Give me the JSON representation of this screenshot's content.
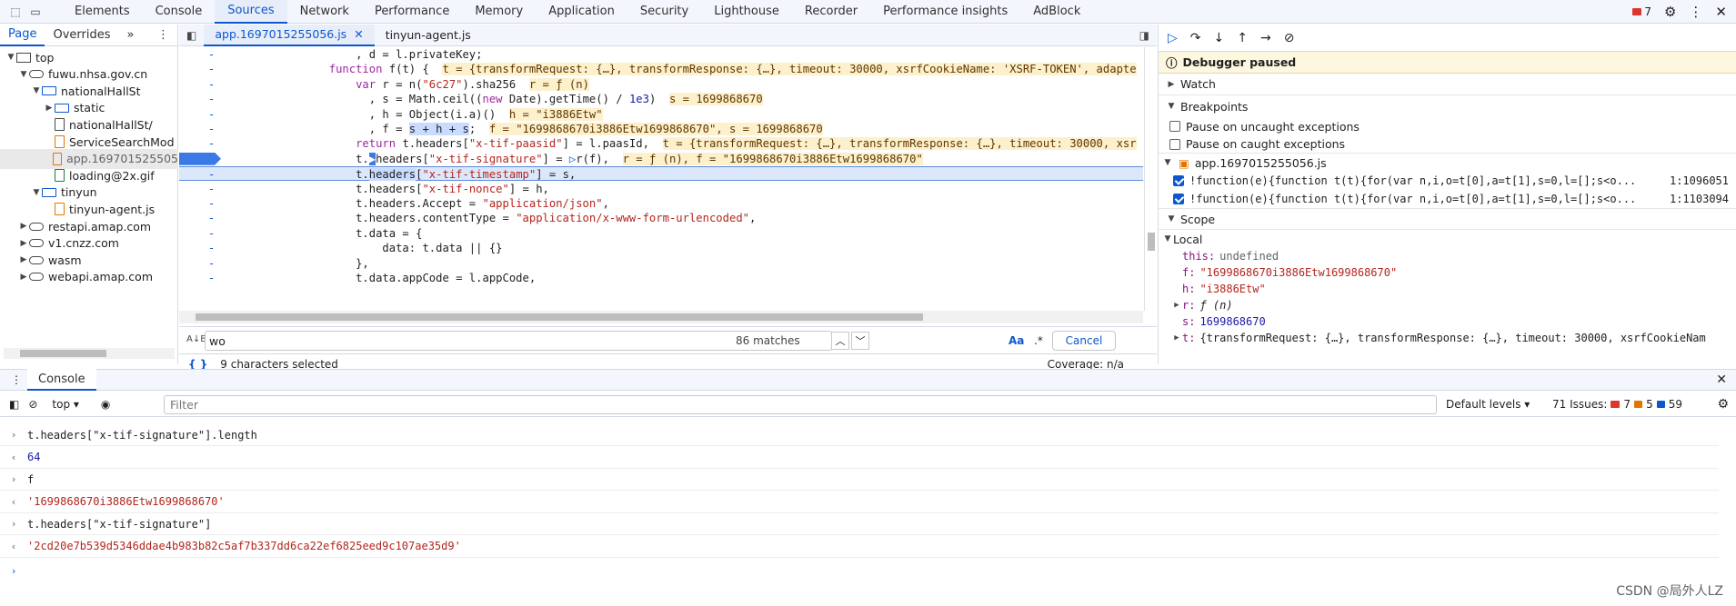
{
  "top_tabs": [
    "Elements",
    "Console",
    "Sources",
    "Network",
    "Performance",
    "Memory",
    "Application",
    "Security",
    "Lighthouse",
    "Recorder",
    "Performance insights",
    "AdBlock"
  ],
  "active_top_tab": "Sources",
  "error_count": "7",
  "navigator": {
    "tabs": [
      "Page",
      "Overrides"
    ],
    "tree": [
      {
        "label": "top",
        "depth": 0,
        "type": "frame",
        "open": true
      },
      {
        "label": "fuwu.nhsa.gov.cn",
        "depth": 1,
        "type": "cloud",
        "open": true
      },
      {
        "label": "nationalHallSt",
        "depth": 2,
        "type": "folder",
        "open": true
      },
      {
        "label": "static",
        "depth": 3,
        "type": "folder",
        "open": false
      },
      {
        "label": "nationalHallSt/",
        "depth": 3,
        "type": "file"
      },
      {
        "label": "ServiceSearchMod",
        "depth": 3,
        "type": "fileo"
      },
      {
        "label": "app.169701525505",
        "depth": 3,
        "type": "fileo",
        "selected": true
      },
      {
        "label": "loading@2x.gif",
        "depth": 3,
        "type": "fileg"
      },
      {
        "label": "tinyun",
        "depth": 2,
        "type": "folder",
        "open": true
      },
      {
        "label": "tinyun-agent.js",
        "depth": 3,
        "type": "fileo"
      },
      {
        "label": "restapi.amap.com",
        "depth": 1,
        "type": "cloud",
        "open": false
      },
      {
        "label": "v1.cnzz.com",
        "depth": 1,
        "type": "cloud",
        "open": false
      },
      {
        "label": "wasm",
        "depth": 1,
        "type": "cloud",
        "open": false
      },
      {
        "label": "webapi.amap.com",
        "depth": 1,
        "type": "cloud",
        "open": false
      }
    ]
  },
  "editor": {
    "tabs": [
      {
        "label": "app.1697015255056.js",
        "active": true
      },
      {
        "label": "tinyun-agent.js",
        "active": false
      }
    ],
    "search_value": "wo",
    "match_count": "86 matches",
    "case_label": "Aa",
    "regex_label": ".*",
    "cancel_label": "Cancel",
    "selection_status": "9 characters selected",
    "coverage": "Coverage: n/a"
  },
  "debugger": {
    "paused_label": "Debugger paused",
    "watch_label": "Watch",
    "breakpoints_label": "Breakpoints",
    "pause_uncaught": "Pause on uncaught exceptions",
    "pause_caught": "Pause on caught exceptions",
    "bp_file": "app.1697015255056.js",
    "bp_items": [
      {
        "code": "!function(e){function t(t){for(var n,i,o=t[0],a=t[1],s=0,l=[];s<o...",
        "loc": "1:1096051"
      },
      {
        "code": "!function(e){function t(t){for(var n,i,o=t[0],a=t[1],s=0,l=[];s<o...",
        "loc": "1:1103094"
      }
    ],
    "scope_label": "Scope",
    "local_label": "Local",
    "vars": [
      {
        "name": "this:",
        "value": "undefined",
        "kind": "dim"
      },
      {
        "name": "f:",
        "value": "\"1699868670i3886Etw1699868670\"",
        "kind": "str"
      },
      {
        "name": "h:",
        "value": "\"i3886Etw\"",
        "kind": "str"
      },
      {
        "name": "r:",
        "value": "ƒ (n)",
        "kind": "fn"
      },
      {
        "name": "s:",
        "value": "1699868670",
        "kind": "num"
      },
      {
        "name": "t:",
        "value": "{transformRequest: {…}, transformResponse: {…}, timeout: 30000, xsrfCookieNam",
        "kind": "obj"
      }
    ]
  },
  "console": {
    "tab_label": "Console",
    "context": "top",
    "filter_placeholder": "Filter",
    "levels": "Default levels",
    "issues_label": "71 Issues:",
    "issues_red": "7",
    "issues_orange": "5",
    "issues_blue": "59",
    "lines": [
      {
        "dir": ">",
        "text": "t.headers[\"x-tif-signature\"].length",
        "kind": "in"
      },
      {
        "dir": "<",
        "text": "64",
        "kind": "num"
      },
      {
        "dir": ">",
        "text": "f",
        "kind": "in"
      },
      {
        "dir": "<",
        "text": "'1699868670i3886Etw1699868670'",
        "kind": "str"
      },
      {
        "dir": ">",
        "text": "t.headers[\"x-tif-signature\"]",
        "kind": "in"
      },
      {
        "dir": "<",
        "text": "'2cd20e7b539d5346ddae4b983b82c5af7b337dd6ca22ef6825eed9c107ae35d9'",
        "kind": "str"
      }
    ]
  },
  "watermark": "CSDN @局外人LZ"
}
